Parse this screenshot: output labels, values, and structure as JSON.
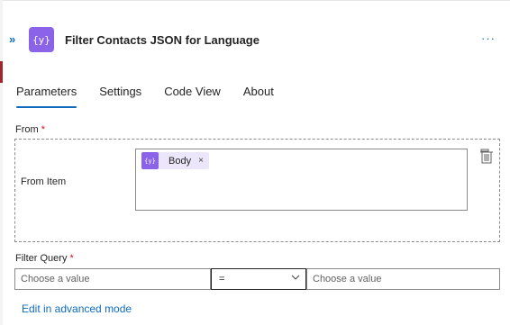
{
  "header": {
    "title": "Filter Contacts JSON for Language",
    "collapse_glyph": "»",
    "icon_glyph": "{y}",
    "more_glyph": "···",
    "icon_color": "#8a63e8"
  },
  "tabs": [
    {
      "label": "Parameters",
      "active": true
    },
    {
      "label": "Settings",
      "active": false
    },
    {
      "label": "Code View",
      "active": false
    },
    {
      "label": "About",
      "active": false
    }
  ],
  "from": {
    "label": "From",
    "required_mark": "*",
    "item_label": "From Item",
    "token": {
      "label": "Body",
      "icon_glyph": "{y}",
      "remove_glyph": "×"
    }
  },
  "filter_query": {
    "label": "Filter Query",
    "required_mark": "*",
    "left_placeholder": "Choose a value",
    "operator": "=",
    "right_placeholder": "Choose a value"
  },
  "advanced_link": "Edit in advanced mode",
  "colors": {
    "accent": "#0f6cbd",
    "required": "#c50f1f",
    "token_bg": "#ece6fb"
  }
}
